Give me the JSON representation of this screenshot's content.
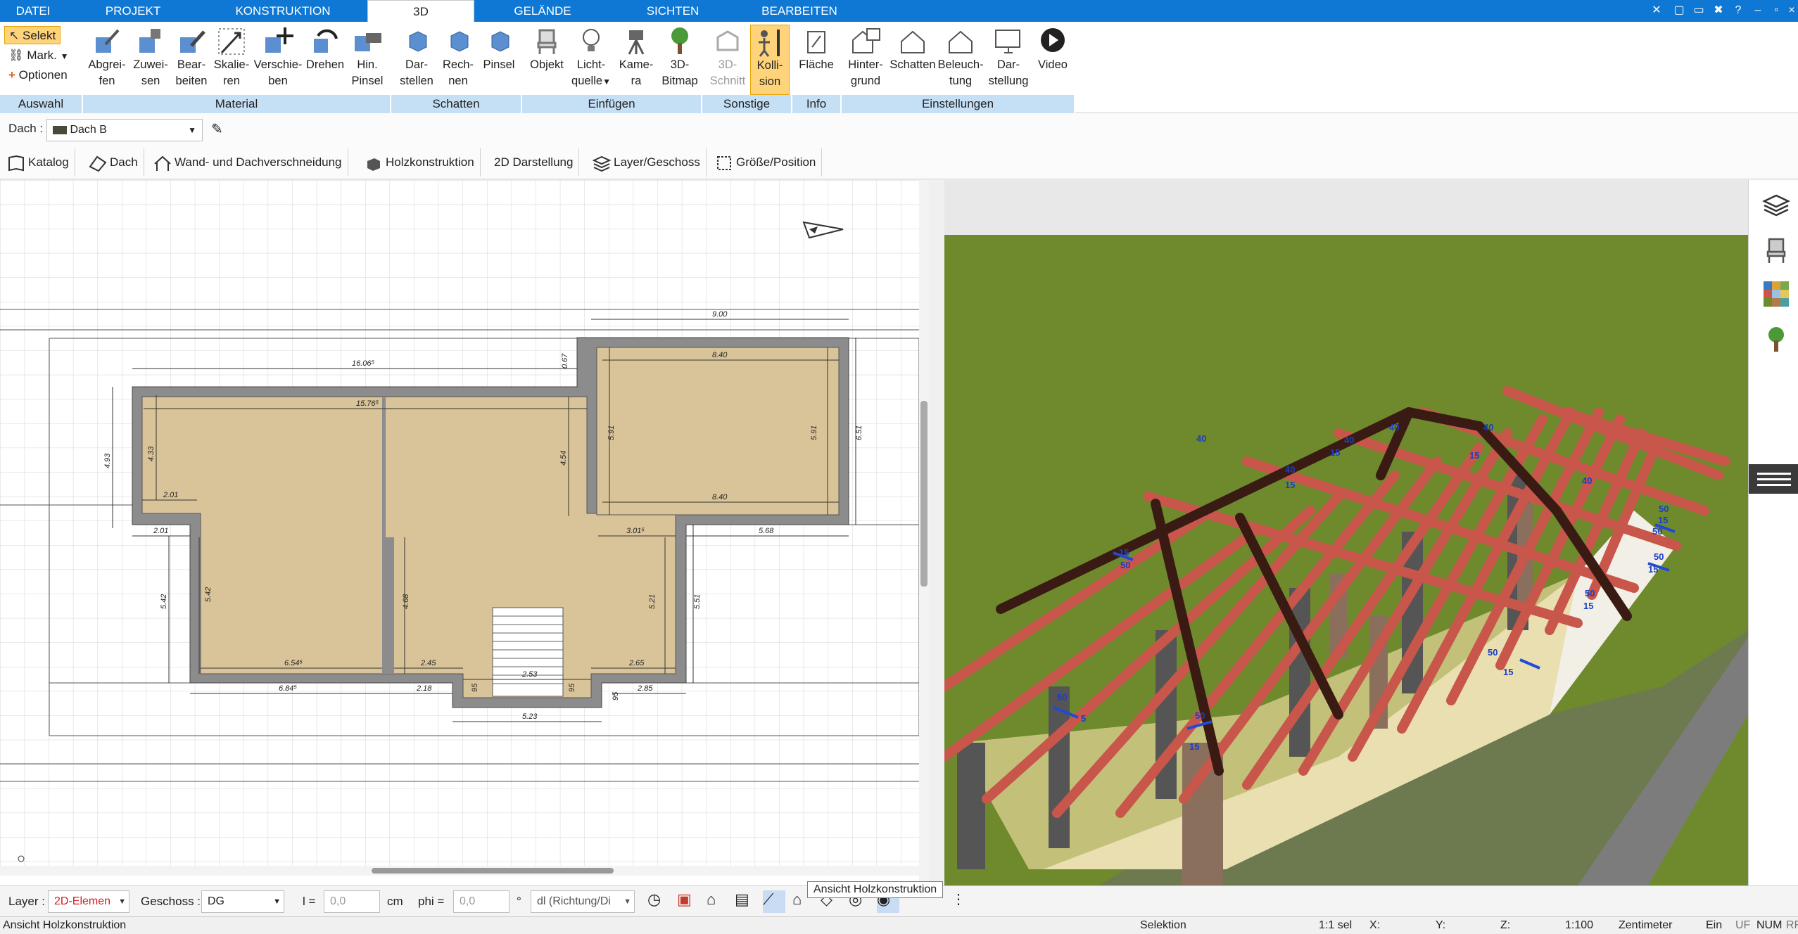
{
  "tabs": [
    {
      "label": "DATEI",
      "active": false
    },
    {
      "label": "PROJEKT",
      "active": false
    },
    {
      "label": "KONSTRUKTION",
      "active": false
    },
    {
      "label": "3D",
      "active": true
    },
    {
      "label": "GELÄNDE",
      "active": false
    },
    {
      "label": "SICHTEN",
      "active": false
    },
    {
      "label": "BEARBEITEN",
      "active": false
    }
  ],
  "colors": {
    "accent": "#0e78d4",
    "group_band": "#c5dff5",
    "active_button": "#ffd37a",
    "rafter": "#c8564b",
    "grass": "#6e8a2c",
    "floor": "#d9c49a"
  },
  "ribbon": {
    "auswahl": {
      "selekt": "Selekt",
      "mark": "Mark.",
      "optionen": "Optionen",
      "group": "Auswahl"
    },
    "material": {
      "group": "Material",
      "buttons": [
        {
          "l1": "Abgrei-",
          "l2": "fen",
          "icon": "eyedropper-icon"
        },
        {
          "l1": "Zuwei-",
          "l2": "sen",
          "icon": "assign-icon"
        },
        {
          "l1": "Bear-",
          "l2": "beiten",
          "icon": "edit-material-icon"
        },
        {
          "l1": "Skalie-",
          "l2": "ren",
          "icon": "scale-icon"
        },
        {
          "l1": "Verschie-",
          "l2": "ben",
          "icon": "move-icon"
        },
        {
          "l1": "Drehen",
          "l2": "",
          "icon": "rotate-icon"
        },
        {
          "l1": "Hin.",
          "l2": "Pinsel",
          "icon": "brush-icon"
        }
      ]
    },
    "schatten": {
      "group": "Schatten",
      "buttons": [
        {
          "l1": "Dar-",
          "l2": "stellen",
          "icon": "cube-shadow-icon"
        },
        {
          "l1": "Rech-",
          "l2": "nen",
          "icon": "cube-calc-icon"
        },
        {
          "l1": "Pinsel",
          "l2": "",
          "icon": "cube-brush-icon"
        }
      ]
    },
    "einfuegen": {
      "group": "Einfügen",
      "buttons": [
        {
          "l1": "Objekt",
          "l2": "",
          "icon": "chair-icon"
        },
        {
          "l1": "Licht-",
          "l2": "quelle",
          "icon": "lightbulb-icon"
        },
        {
          "l1": "Kame-",
          "l2": "ra",
          "icon": "camera-icon"
        },
        {
          "l1": "3D-",
          "l2": "Bitmap",
          "icon": "tree-icon"
        }
      ]
    },
    "sonstige": {
      "group": "Sonstige",
      "buttons": [
        {
          "l1": "3D-",
          "l2": "Schnitt",
          "icon": "section-icon"
        },
        {
          "l1": "Kolli-",
          "l2": "sion",
          "icon": "collision-icon"
        }
      ]
    },
    "info": {
      "group": "Info",
      "buttons": [
        {
          "l1": "Fläche",
          "l2": "",
          "icon": "area-icon"
        }
      ]
    },
    "einstellungen": {
      "group": "Einstellungen",
      "buttons": [
        {
          "l1": "Hinter-",
          "l2": "grund",
          "icon": "background-icon"
        },
        {
          "l1": "Schatten",
          "l2": "",
          "icon": "house-shadow-icon"
        },
        {
          "l1": "Beleuch-",
          "l2": "tung",
          "icon": "house-light-icon"
        },
        {
          "l1": "Dar-",
          "l2": "stellung",
          "icon": "monitor-icon"
        },
        {
          "l1": "Video",
          "l2": "",
          "icon": "play-icon"
        }
      ]
    }
  },
  "toolbar2": {
    "dach_label": "Dach :",
    "dach_value": "Dach B",
    "buttons": [
      {
        "label": "Katalog",
        "icon": "catalog-icon"
      },
      {
        "label": "Dach",
        "icon": "roof-icon"
      },
      {
        "label": "Wand- und Dachverschneidung",
        "icon": "roof-wall-icon"
      },
      {
        "label": "Holzkonstruktion",
        "icon": "timber-icon"
      },
      {
        "label": "2D Darstellung",
        "icon": ""
      },
      {
        "label": "Layer/Geschoss",
        "icon": "layers-icon"
      },
      {
        "label": "Größe/Position",
        "icon": "size-position-icon"
      }
    ]
  },
  "plan_dims": {
    "d900": "9.00",
    "d1606": "16.06⁵",
    "d840top": "8.40",
    "d840bot": "8.40",
    "d067": "0.67",
    "d1576": "15.76⁵",
    "d493": "4.93",
    "d433": "4.33",
    "d201a": "2.01",
    "d201b": "2.01",
    "d454": "4.54",
    "d591a": "5.91",
    "d591b": "5.91",
    "d651": "6.51",
    "d301": "3.01⁵",
    "d568": "5.68",
    "d542a": "5.42",
    "d542b": "5.42",
    "d468": "4.68",
    "d521": "5.21",
    "d551": "5.51",
    "d654": "6.54⁵",
    "d245": "2.45",
    "d265": "2.65",
    "d253": "2.53",
    "d684": "6.84⁵",
    "d218": "2.18",
    "d95a": "95",
    "d95b": "95",
    "d95c": "95",
    "d285": "2.85",
    "d523": "5.23"
  },
  "rafter_labels": [
    "40",
    "40",
    "15",
    "40",
    "15",
    "40",
    "15",
    "40",
    "40",
    "15",
    "50",
    "50",
    "15",
    "50",
    "50",
    "15",
    "50",
    "15",
    "50",
    "15",
    "50",
    "5",
    "50",
    "15"
  ],
  "bottombar": {
    "layer_label": "Layer :",
    "layer_value": "2D-Elemen",
    "geschoss_label": "Geschoss :",
    "geschoss_value": "DG",
    "l_label": "l =",
    "l_value": "0,0",
    "l_unit": "cm",
    "phi_label": "phi =",
    "phi_value": "0,0",
    "phi_unit": "°",
    "dl_value": "dl (Richtung/Di",
    "tooltip": "Ansicht Holzkonstruktion"
  },
  "statusbar": {
    "left": "Ansicht Holzkonstruktion",
    "selektion": "Selektion",
    "sel": "1:1 sel",
    "x": "X:",
    "y": "Y:",
    "z": "Z:",
    "scale": "1:100",
    "unit": "Zentimeter",
    "ein": "Ein",
    "uf": "UF",
    "num": "NUM",
    "rf": "RF"
  }
}
